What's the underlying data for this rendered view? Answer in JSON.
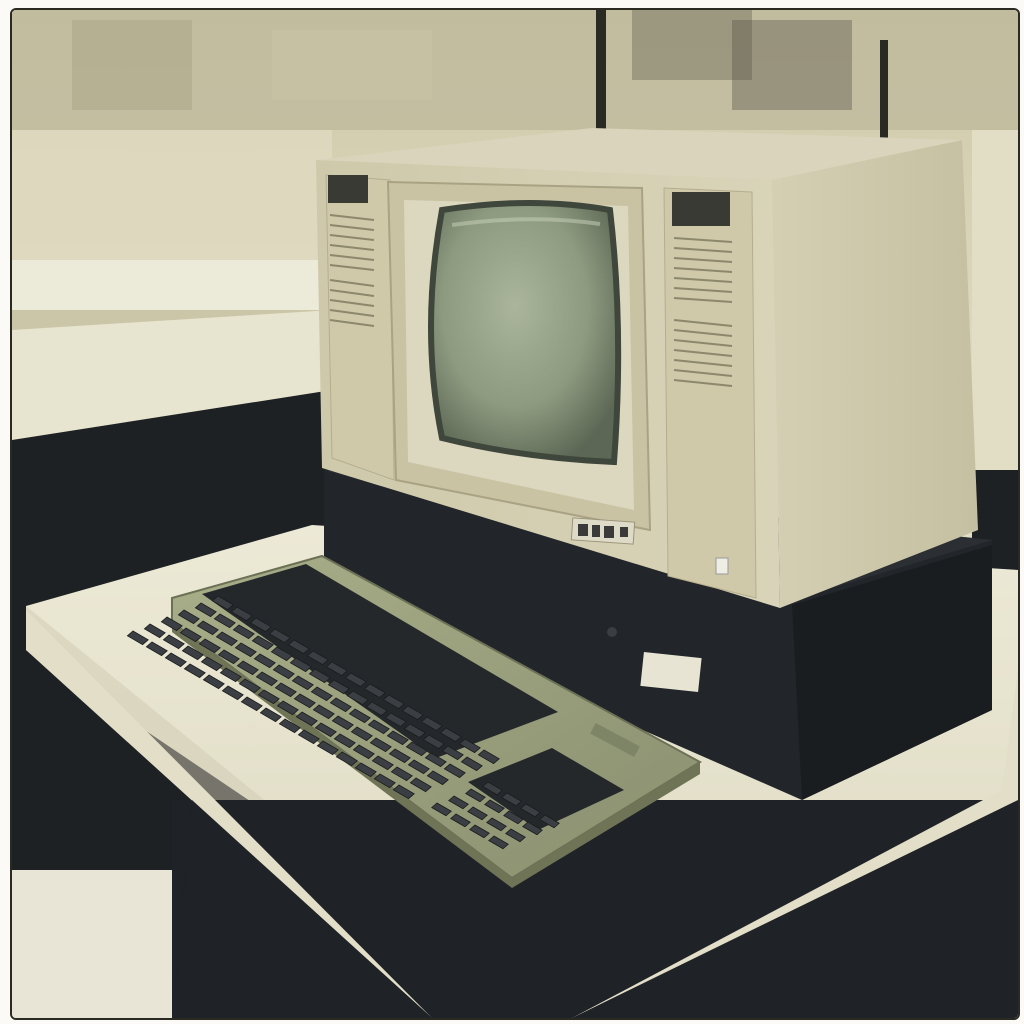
{
  "monitor": {
    "badge_text": ""
  },
  "label": {
    "text": ""
  },
  "colors": {
    "case_beige": "#d6d0b4",
    "case_shadow": "#b7b08f",
    "screen_green": "#8d9a7f",
    "keyboard_olive": "#9aa27a",
    "key_dark": "#2b2e31",
    "desk_top": "#e6e3cf",
    "desk_base": "#1f2226"
  }
}
